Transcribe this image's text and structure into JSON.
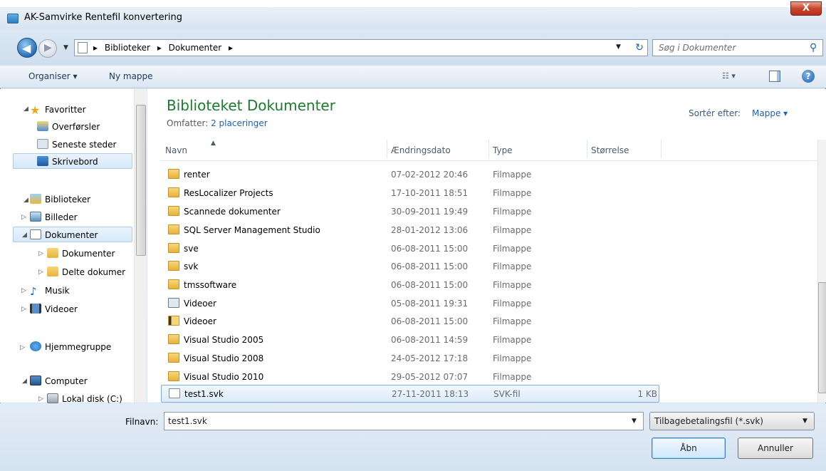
{
  "window": {
    "title": "AK-Samvirke Rentefil konvertering",
    "close_label": "X"
  },
  "address": {
    "crumbs": [
      "Biblioteker",
      "Dokumenter"
    ],
    "search_placeholder": "Søg i Dokumenter"
  },
  "toolbar": {
    "organize": "Organiser ▾",
    "new_folder": "Ny mappe"
  },
  "nav": {
    "favorites": "Favoritter",
    "downloads": "Overførsler",
    "recent": "Seneste steder",
    "desktop": "Skrivebord",
    "libraries": "Biblioteker",
    "pictures": "Billeder",
    "documents": "Dokumenter",
    "my_documents": "Dokumenter",
    "shared_documents": "Delte dokumer",
    "music": "Musik",
    "videos": "Videoer",
    "homegroup": "Hjemmegruppe",
    "computer": "Computer",
    "local_disk": "Lokal disk (C:)"
  },
  "library": {
    "title": "Biblioteket Dokumenter",
    "includes_label": "Omfatter:",
    "includes_link": "2 placeringer"
  },
  "sort": {
    "label": "Sortér efter:",
    "value": "Mappe ▾"
  },
  "columns": {
    "name": "Navn",
    "date": "Ændringsdato",
    "type": "Type",
    "size": "Størrelse"
  },
  "rows": [
    {
      "name": "renter",
      "date": "07-02-2012 20:46",
      "type": "Filmappe",
      "size": ""
    },
    {
      "name": "ResLocalizer Projects",
      "date": "17-10-2011 18:51",
      "type": "Filmappe",
      "size": ""
    },
    {
      "name": "Scannede dokumenter",
      "date": "30-09-2011 19:49",
      "type": "Filmappe",
      "size": ""
    },
    {
      "name": "SQL Server Management Studio",
      "date": "28-01-2012 13:06",
      "type": "Filmappe",
      "size": ""
    },
    {
      "name": "sve",
      "date": "06-08-2011 15:00",
      "type": "Filmappe",
      "size": ""
    },
    {
      "name": "svk",
      "date": "06-08-2011 15:00",
      "type": "Filmappe",
      "size": ""
    },
    {
      "name": "tmssoftware",
      "date": "06-08-2011 15:00",
      "type": "Filmappe",
      "size": ""
    },
    {
      "name": "Videoer",
      "date": "05-08-2011 19:31",
      "type": "Filmappe",
      "size": ""
    },
    {
      "name": "Videoer",
      "date": "06-08-2011 15:00",
      "type": "Filmappe",
      "size": ""
    },
    {
      "name": "Visual Studio 2005",
      "date": "06-08-2011 14:59",
      "type": "Filmappe",
      "size": ""
    },
    {
      "name": "Visual Studio 2008",
      "date": "24-05-2012 17:18",
      "type": "Filmappe",
      "size": ""
    },
    {
      "name": "Visual Studio 2010",
      "date": "29-05-2012 07:07",
      "type": "Filmappe",
      "size": ""
    },
    {
      "name": "test1.svk",
      "date": "27-11-2011 18:13",
      "type": "SVK-fil",
      "size": "1 KB"
    }
  ],
  "bottom": {
    "filename_label": "Filnavn:",
    "filename_value": "test1.svk",
    "filetype": "Tilbagebetalingsfil (*.svk)",
    "open": "Åbn",
    "cancel": "Annuller"
  }
}
